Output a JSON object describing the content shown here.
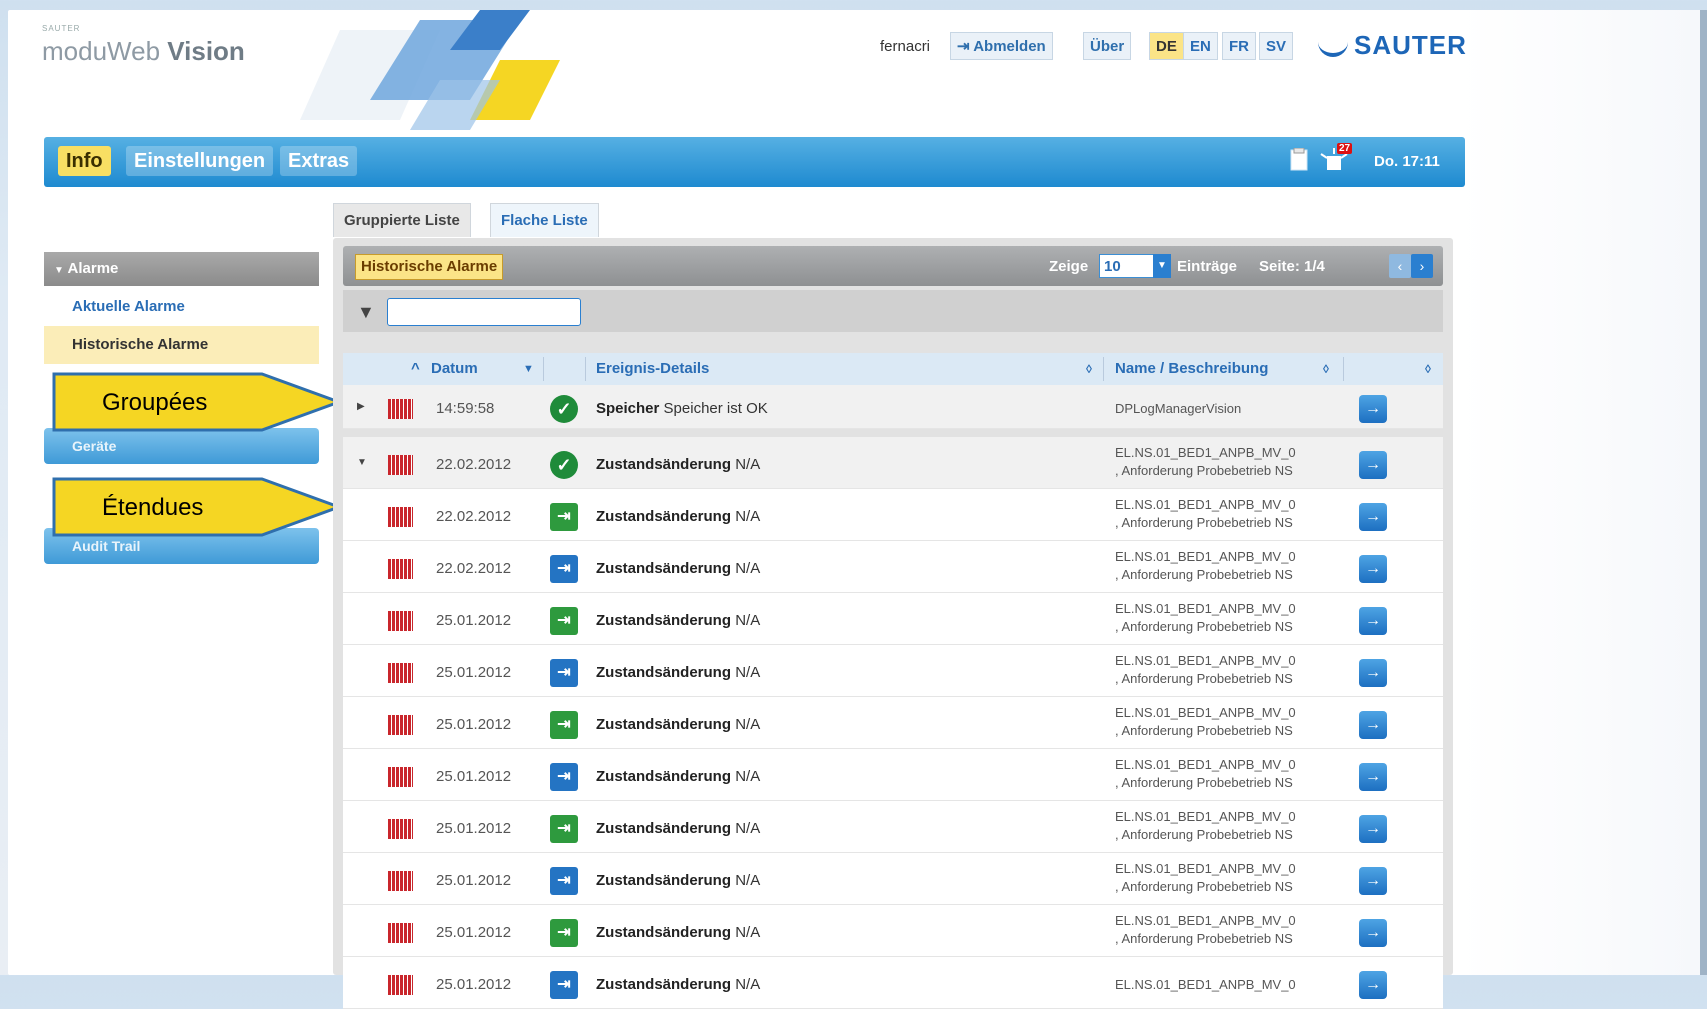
{
  "header": {
    "brand_small": "SAUTER",
    "brand_prefix": "moduWeb",
    "brand_suffix": "Vision",
    "user": "fernacri",
    "logout_label": "Abmelden",
    "about_label": "Über",
    "languages": [
      "DE",
      "EN",
      "FR",
      "SV"
    ],
    "active_language": "DE",
    "logo_text": "SAUTER"
  },
  "nav": {
    "tabs": [
      "Info",
      "Einstellungen",
      "Extras"
    ],
    "active_tab": "Info",
    "badge_count": "27",
    "clock": "Do. 17:11"
  },
  "sidebar": {
    "section_title": "Alarme",
    "items": [
      "Aktuelle Alarme",
      "Historische Alarme"
    ],
    "selected_item": "Historische Alarme",
    "buttons": [
      "Geräte",
      "Audit Trail"
    ]
  },
  "callouts": {
    "grouped": "Groupées",
    "expanded": "Étendues"
  },
  "content_tabs": [
    "Gruppierte Liste",
    "Flache Liste"
  ],
  "panel": {
    "title": "Historische Alarme",
    "show_label": "Zeige",
    "entries_value": "10",
    "entries_label": "Einträge",
    "page_label": "Seite: 1/4",
    "filter_value": ""
  },
  "table": {
    "columns": [
      "Datum",
      "Ereignis-Details",
      "Name / Beschreibung"
    ],
    "rows": [
      {
        "date": "14:59:58",
        "status": "ok",
        "event": "Speicher",
        "detail": "Speicher ist OK",
        "name1": "DPLogManagerVision",
        "name2": "",
        "group": "collapsed"
      },
      {
        "date": "22.02.2012",
        "status": "ok",
        "event": "Zustandsänderung",
        "detail": "N/A",
        "name1": "EL.NS.01_BED1_ANPB_MV_0",
        "name2": ", Anforderung Probebetrieb NS",
        "group": "expanded"
      },
      {
        "date": "22.02.2012",
        "status": "green",
        "event": "Zustandsänderung",
        "detail": "N/A",
        "name1": "EL.NS.01_BED1_ANPB_MV_0",
        "name2": ", Anforderung Probebetrieb NS",
        "group": ""
      },
      {
        "date": "22.02.2012",
        "status": "blue",
        "event": "Zustandsänderung",
        "detail": "N/A",
        "name1": "EL.NS.01_BED1_ANPB_MV_0",
        "name2": ", Anforderung Probebetrieb NS",
        "group": ""
      },
      {
        "date": "25.01.2012",
        "status": "green",
        "event": "Zustandsänderung",
        "detail": "N/A",
        "name1": "EL.NS.01_BED1_ANPB_MV_0",
        "name2": ", Anforderung Probebetrieb NS",
        "group": ""
      },
      {
        "date": "25.01.2012",
        "status": "blue",
        "event": "Zustandsänderung",
        "detail": "N/A",
        "name1": "EL.NS.01_BED1_ANPB_MV_0",
        "name2": ", Anforderung Probebetrieb NS",
        "group": ""
      },
      {
        "date": "25.01.2012",
        "status": "green",
        "event": "Zustandsänderung",
        "detail": "N/A",
        "name1": "EL.NS.01_BED1_ANPB_MV_0",
        "name2": ", Anforderung Probebetrieb NS",
        "group": ""
      },
      {
        "date": "25.01.2012",
        "status": "blue",
        "event": "Zustandsänderung",
        "detail": "N/A",
        "name1": "EL.NS.01_BED1_ANPB_MV_0",
        "name2": ", Anforderung Probebetrieb NS",
        "group": ""
      },
      {
        "date": "25.01.2012",
        "status": "green",
        "event": "Zustandsänderung",
        "detail": "N/A",
        "name1": "EL.NS.01_BED1_ANPB_MV_0",
        "name2": ", Anforderung Probebetrieb NS",
        "group": ""
      },
      {
        "date": "25.01.2012",
        "status": "blue",
        "event": "Zustandsänderung",
        "detail": "N/A",
        "name1": "EL.NS.01_BED1_ANPB_MV_0",
        "name2": ", Anforderung Probebetrieb NS",
        "group": ""
      },
      {
        "date": "25.01.2012",
        "status": "green",
        "event": "Zustandsänderung",
        "detail": "N/A",
        "name1": "EL.NS.01_BED1_ANPB_MV_0",
        "name2": ", Anforderung Probebetrieb NS",
        "group": ""
      },
      {
        "date": "25.01.2012",
        "status": "blue",
        "event": "Zustandsänderung",
        "detail": "N/A",
        "name1": "EL.NS.01_BED1_ANPB_MV_0",
        "name2": "",
        "group": ""
      }
    ]
  },
  "colors": {
    "nav_blue": "#1e8ad0",
    "highlight_yellow": "#f8df63",
    "severity_red": "#c9262c",
    "status_green": "#2e9a3e",
    "status_blue": "#2474c3",
    "callout_yellow": "#f5d623"
  }
}
